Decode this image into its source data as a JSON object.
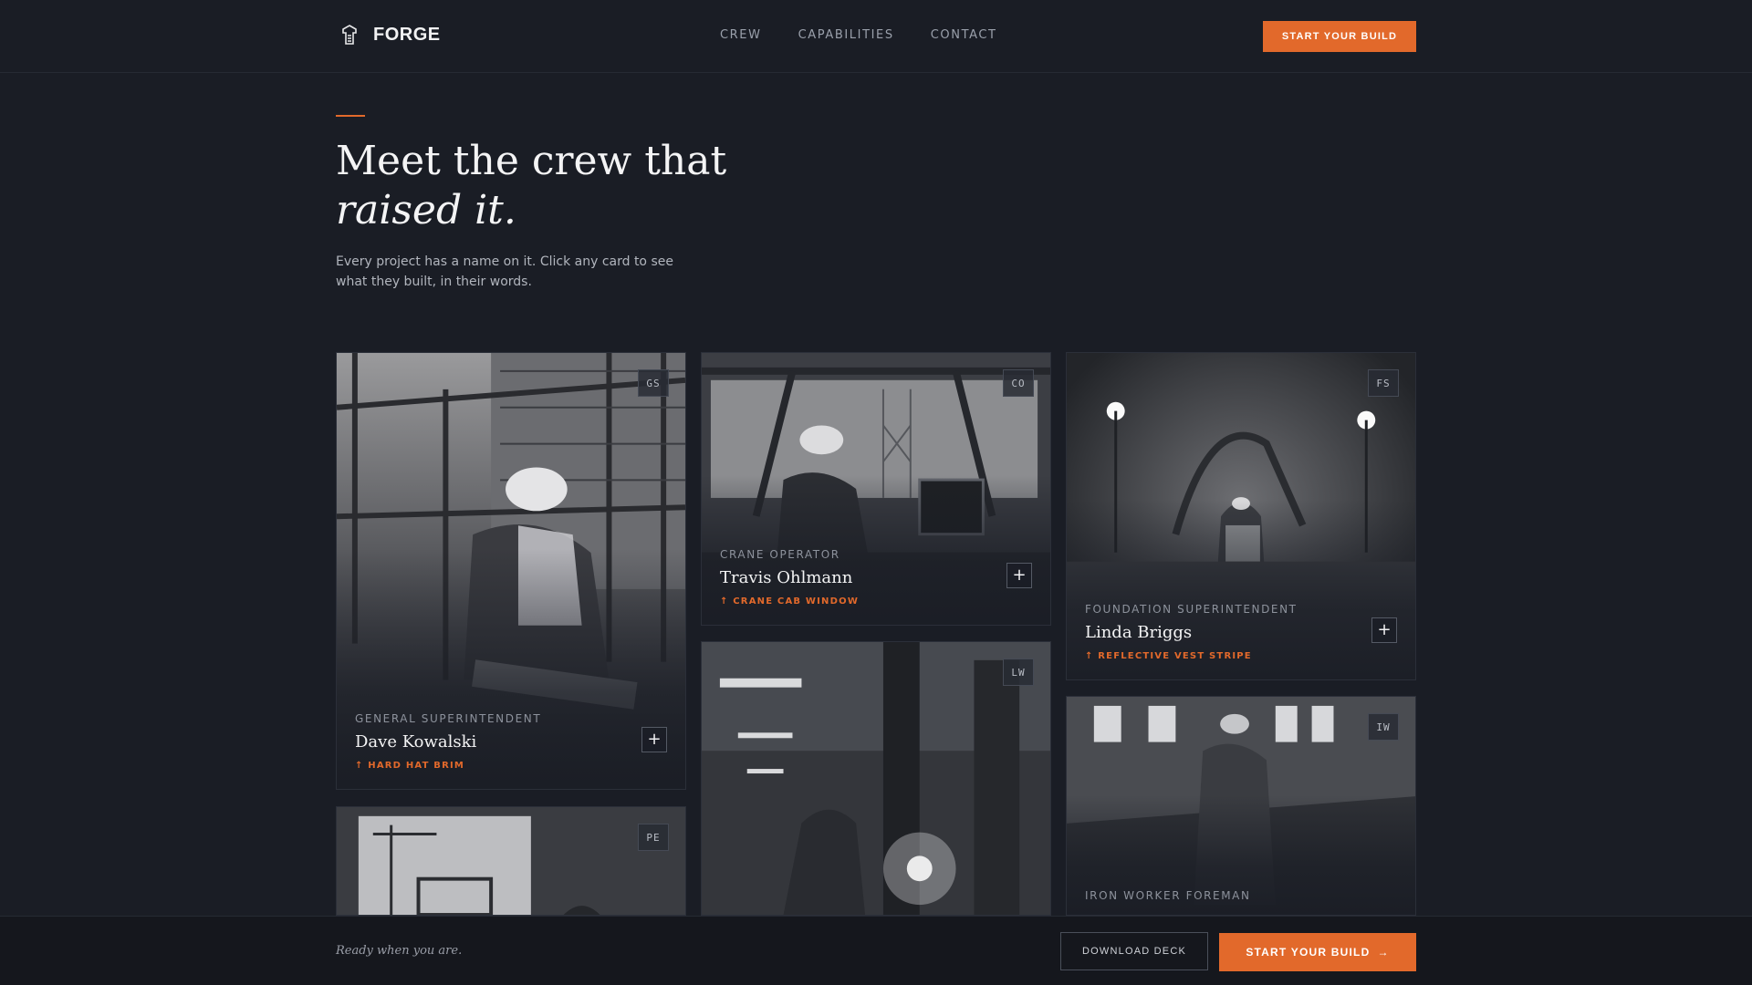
{
  "brand": {
    "name": "FORGE",
    "icon": "forge-logo-icon"
  },
  "nav": {
    "items": [
      "CREW",
      "CAPABILITIES",
      "CONTACT"
    ]
  },
  "header": {
    "cta_label": "START YOUR BUILD"
  },
  "hero": {
    "title_line1": "Meet the crew that",
    "title_line2": "raised it.",
    "subtitle": "Every project has a name on it. Click any card to see what they built, in their words."
  },
  "cards": [
    {
      "badge": "GS",
      "role": "GENERAL SUPERINTENDENT",
      "name": "Dave Kowalski",
      "tag": "↑ HARD HAT BRIM"
    },
    {
      "badge": "CO",
      "role": "CRANE OPERATOR",
      "name": "Travis Ohlmann",
      "tag": "↑ CRANE CAB WINDOW"
    },
    {
      "badge": "FS",
      "role": "FOUNDATION SUPERINTENDENT",
      "name": "Linda Briggs",
      "tag": "↑ REFLECTIVE VEST STRIPE"
    },
    {
      "badge": "LW",
      "role": "",
      "name": "",
      "tag": ""
    },
    {
      "badge": "IW",
      "role": "IRON WORKER FOREMAN",
      "name": "",
      "tag": ""
    },
    {
      "badge": "PE",
      "role": "",
      "name": "",
      "tag": ""
    }
  ],
  "bottom_bar": {
    "tagline": "Ready when you are.",
    "download_label": "DOWNLOAD DECK",
    "build_label": "START YOUR BUILD",
    "build_arrow": "→"
  },
  "colors": {
    "accent": "#e2692b",
    "background": "#1a1d25"
  }
}
